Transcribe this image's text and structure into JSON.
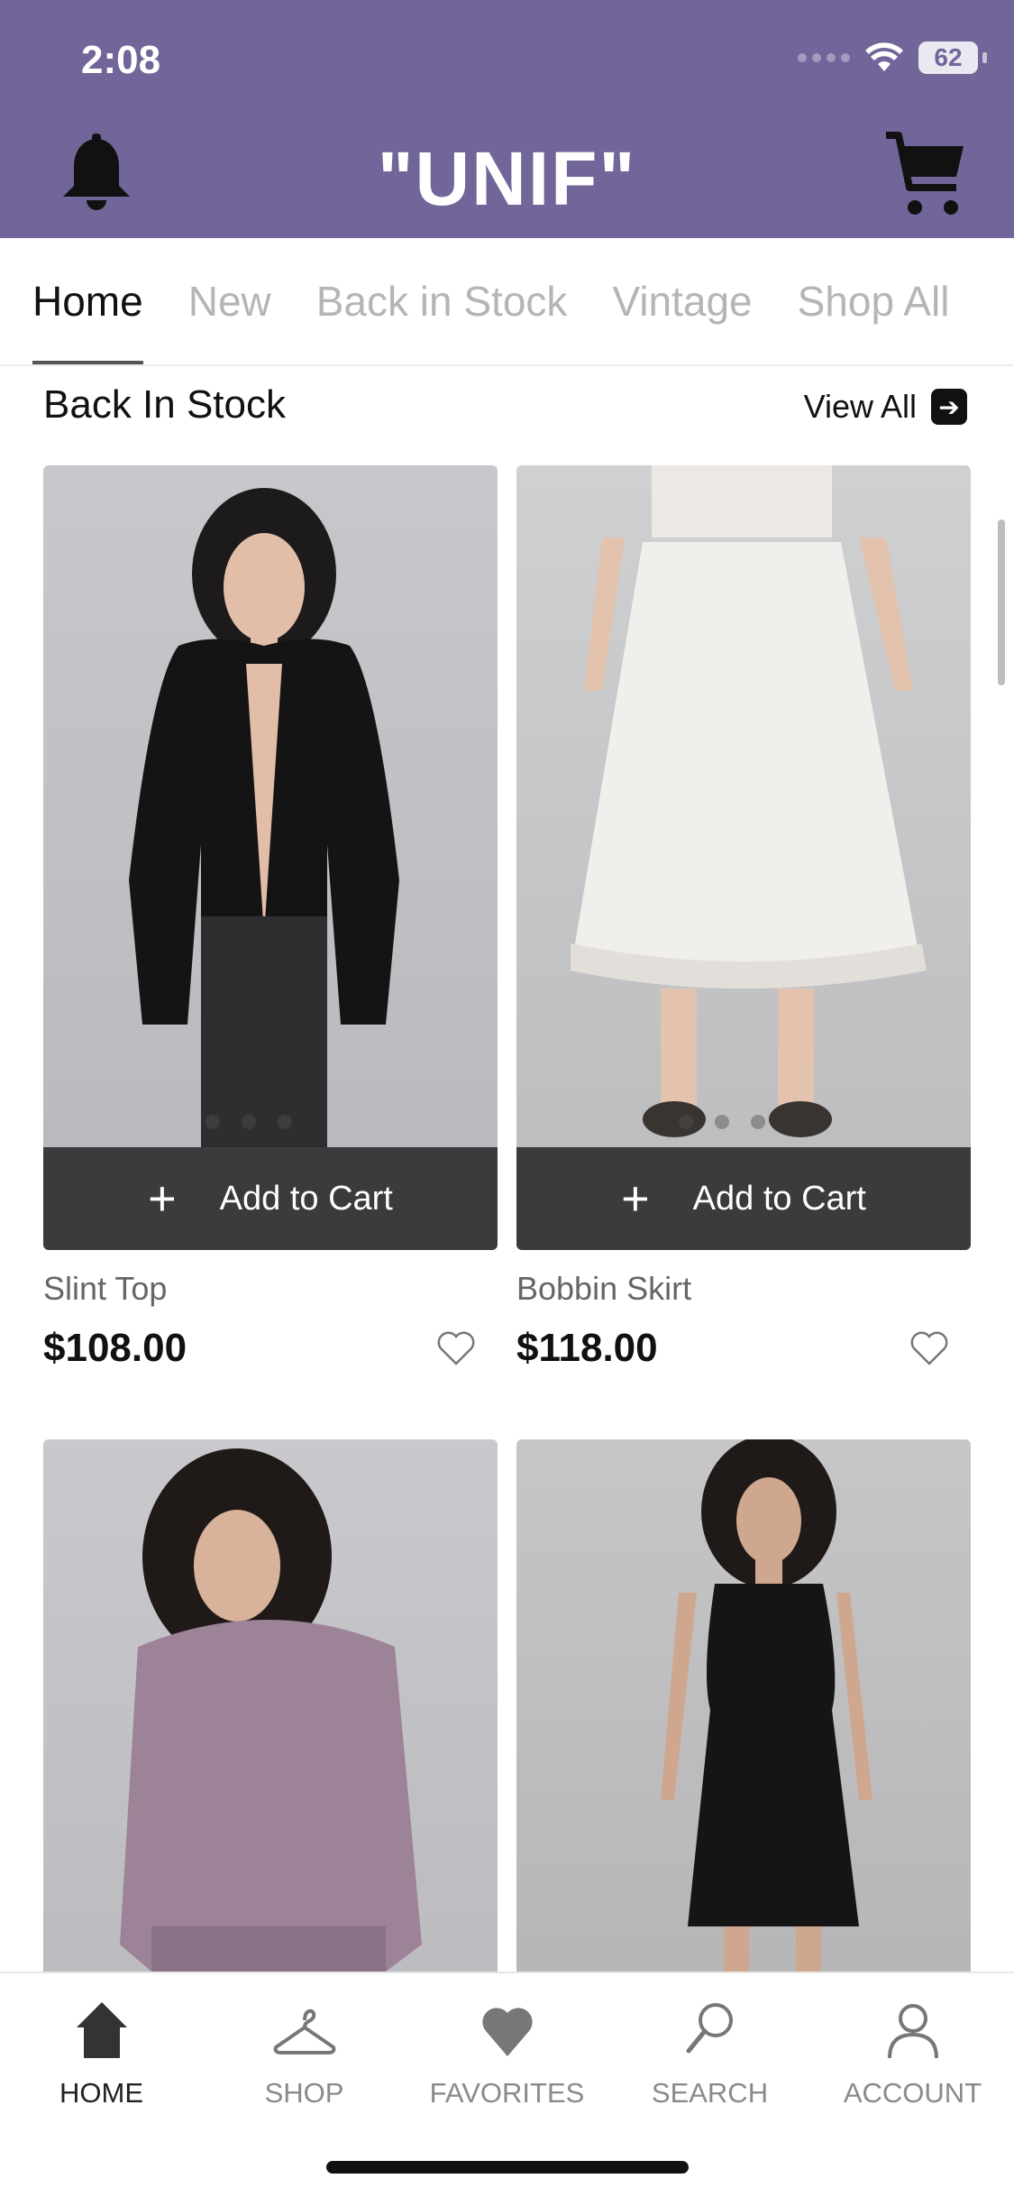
{
  "status_bar": {
    "time": "2:08",
    "battery": "62"
  },
  "header": {
    "logo": "\"UNIF\"",
    "bell_icon": "bell-icon",
    "cart_icon": "cart-icon",
    "background": "#72659a"
  },
  "tabs": [
    {
      "label": "Home"
    },
    {
      "label": "New"
    },
    {
      "label": "Back in Stock"
    },
    {
      "label": "Vintage"
    },
    {
      "label": "Shop All"
    }
  ],
  "section": {
    "title": "Back In Stock",
    "view_all": "View All",
    "arrow_icon": "arrow-right-icon"
  },
  "products": [
    {
      "name": "Slint Top",
      "price": "$108.00",
      "add_to_cart": "Add to Cart"
    },
    {
      "name": "Bobbin Skirt",
      "price": "$118.00",
      "add_to_cart": "Add to Cart"
    }
  ],
  "bottom_nav": [
    {
      "label": "HOME",
      "icon": "home-icon"
    },
    {
      "label": "SHOP",
      "icon": "hanger-icon"
    },
    {
      "label": "FAVORITES",
      "icon": "heart-icon"
    },
    {
      "label": "SEARCH",
      "icon": "search-icon"
    },
    {
      "label": "ACCOUNT",
      "icon": "account-icon"
    }
  ]
}
